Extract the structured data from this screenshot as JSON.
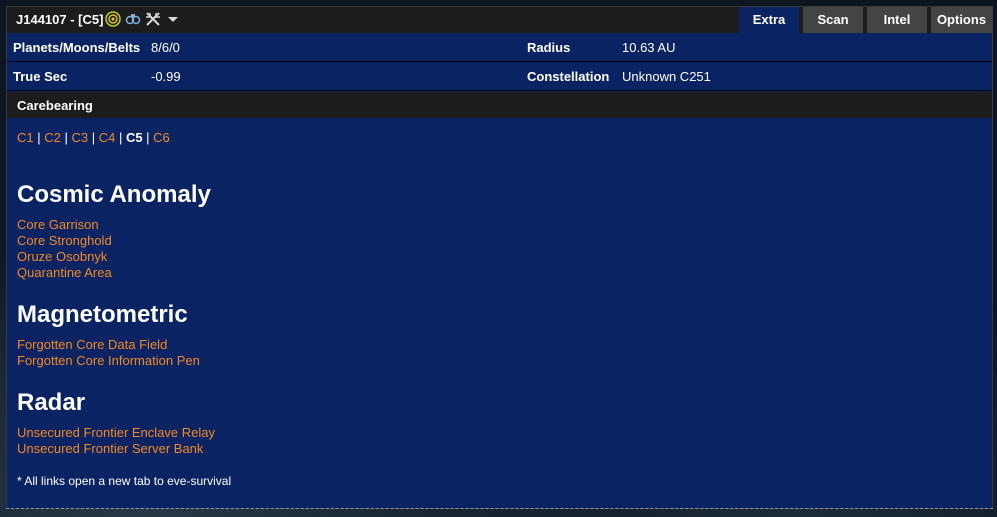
{
  "window": {
    "title": "J144107 - [C5]",
    "icons": [
      "sun-effect-icon",
      "binoculars-icon",
      "crossed-swords-icon",
      "dropdown-arrow-icon"
    ]
  },
  "tabs": [
    {
      "label": "Extra",
      "active": true
    },
    {
      "label": "Scan",
      "active": false
    },
    {
      "label": "Intel",
      "active": false
    },
    {
      "label": "Options",
      "active": false
    }
  ],
  "info": {
    "planets_label": "Planets/Moons/Belts",
    "planets_value": "8/6/0",
    "radius_label": "Radius",
    "radius_value": "10.63 AU",
    "truesec_label": "True Sec",
    "truesec_value": "-0.99",
    "constellation_label": "Constellation",
    "constellation_value": "Unknown C251"
  },
  "section": {
    "title": "Carebearing"
  },
  "classes": {
    "items": [
      "C1",
      "C2",
      "C3",
      "C4",
      "C5",
      "C6"
    ],
    "current": "C5",
    "separator": " | "
  },
  "categories": [
    {
      "title": "Cosmic Anomaly",
      "sites": [
        "Core Garrison",
        "Core Stronghold",
        "Oruze Osobnyk",
        "Quarantine Area"
      ]
    },
    {
      "title": "Magnetometric",
      "sites": [
        "Forgotten Core Data Field",
        "Forgotten Core Information Pen"
      ]
    },
    {
      "title": "Radar",
      "sites": [
        "Unsecured Frontier Enclave Relay",
        "Unsecured Frontier Server Bank"
      ]
    }
  ],
  "footnote": "* All links open a new tab to eve-survival",
  "colors": {
    "panel_bg": "#0a2463",
    "header_bg": "#1c1c1c",
    "link": "#f08a24",
    "text": "#ffffff",
    "tab_inactive": "#444444"
  }
}
